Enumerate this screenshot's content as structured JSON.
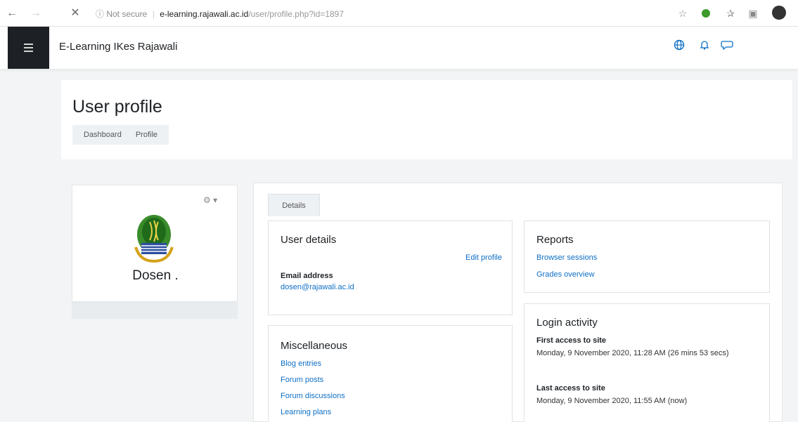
{
  "browser": {
    "back": "←",
    "forward": "→",
    "stop": "✕",
    "not_secure": "ⓘ Not secure",
    "separator": "|",
    "domain": "e-learning.rajawali.ac.id",
    "path": "/user/profile.php?id=1897"
  },
  "navbar": {
    "site_name": "E-Learning IKes Rajawali"
  },
  "header": {
    "title": "User profile",
    "breadcrumb": [
      "Dashboard",
      "Profile"
    ]
  },
  "profile": {
    "name": "Dosen ."
  },
  "tabs": {
    "details": "Details"
  },
  "user_details": {
    "title": "User details",
    "edit_profile": "Edit profile",
    "email_label": "Email address",
    "email_value": "dosen@rajawali.ac.id"
  },
  "reports": {
    "title": "Reports",
    "links": [
      "Browser sessions",
      "Grades overview"
    ]
  },
  "misc": {
    "title": "Miscellaneous",
    "links": [
      "Blog entries",
      "Forum posts",
      "Forum discussions",
      "Learning plans"
    ]
  },
  "login_activity": {
    "title": "Login activity",
    "first_label": "First access to site",
    "first_value": "Monday, 9 November 2020, 11:28 AM  (26 mins 53 secs)",
    "last_label": "Last access to site",
    "last_value": "Monday, 9 November 2020, 11:55 AM  (now)"
  },
  "colors": {
    "accent": "#0f6fc5",
    "drawer": "#1d2125",
    "background": "#f2f4f6"
  }
}
